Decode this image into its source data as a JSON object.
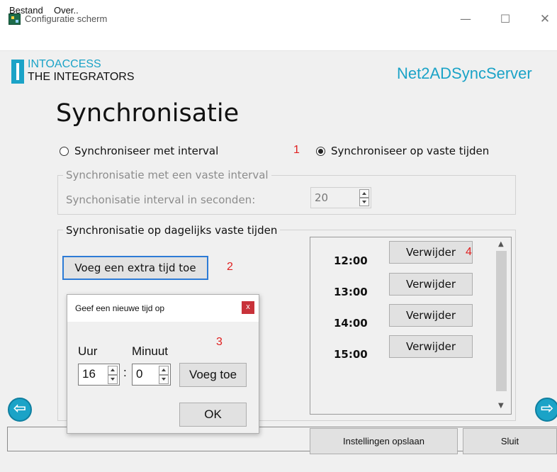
{
  "window": {
    "title": "Configuratie scherm",
    "minimize": "—",
    "maximize": "☐",
    "close": "✕"
  },
  "menu": {
    "file": "Bestand",
    "about": "Over.."
  },
  "header": {
    "brand_line1": "INTOACCESS",
    "brand_line2": "THE INTEGRATORS",
    "product": "Net2ADSyncServer"
  },
  "page": {
    "title": "Synchronisatie"
  },
  "mode": {
    "interval_label": "Synchroniseer met interval",
    "fixed_label": "Synchroniseer op vaste tijden",
    "selected": "fixed"
  },
  "markers": {
    "m1": "1",
    "m2": "2",
    "m3": "3",
    "m4": "4"
  },
  "interval_group": {
    "title": "Synchronisatie met een vaste interval",
    "label": "Synchonisatie interval in seconden:",
    "value": "20"
  },
  "daily_group": {
    "title": "Synchronisatie op dagelijks vaste tijden",
    "add_button": "Voeg een extra tijd toe",
    "remove_label": "Verwijder",
    "times": [
      "12:00",
      "13:00",
      "14:00",
      "15:00"
    ]
  },
  "dialog": {
    "title": "Geef een nieuwe tijd op",
    "close": "x",
    "hour_label": "Uur",
    "minute_label": "Minuut",
    "hour_value": "16",
    "minute_value": "0",
    "separator": ":",
    "add_button": "Voeg toe",
    "ok_button": "OK"
  },
  "footer": {
    "save_button": "Instellingen opslaan",
    "close_button": "Sluit"
  },
  "nav": {
    "back": "⇦",
    "forward": "⇨"
  },
  "colors": {
    "accent": "#1ba3c7",
    "marker": "#e02020",
    "focus": "#2d7bd6"
  }
}
